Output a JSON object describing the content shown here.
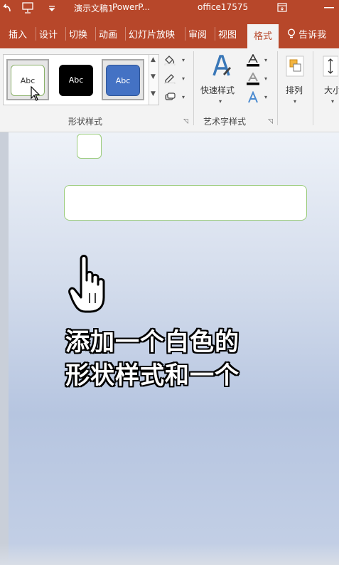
{
  "titlebar": {
    "doc_title": "演示文稿1",
    "app_name": "PowerP...",
    "account": "office17575"
  },
  "tabs": [
    {
      "label": "插入"
    },
    {
      "label": "设计"
    },
    {
      "label": "切换"
    },
    {
      "label": "动画"
    },
    {
      "label": "幻灯片放映"
    },
    {
      "label": "审阅"
    },
    {
      "label": "视图"
    }
  ],
  "active_tab": "格式",
  "tell_me": "告诉我",
  "ribbon": {
    "shape_styles": {
      "group_label": "形状样式",
      "items": [
        {
          "label": "Abc",
          "fill": "#ffffff",
          "outline": "#8ab06a",
          "text_color": "#333333",
          "selected": true
        },
        {
          "label": "Abc",
          "fill": "#000000",
          "outline": "#000000",
          "text_color": "#ffffff",
          "selected": false
        },
        {
          "label": "Abc",
          "fill": "#4472c4",
          "outline": "#2f5597",
          "text_color": "#ffffff",
          "selected": false
        }
      ]
    },
    "wordart": {
      "group_label": "艺术字样式",
      "quick_styles_label": "快速样式"
    },
    "arrange_label": "排列",
    "size_label": "大小"
  },
  "caption": {
    "line1": "添加一个白色的",
    "line2": "形状样式和一个"
  },
  "colors": {
    "accent": "#b7472a",
    "shape_outline": "#9acb7a"
  }
}
